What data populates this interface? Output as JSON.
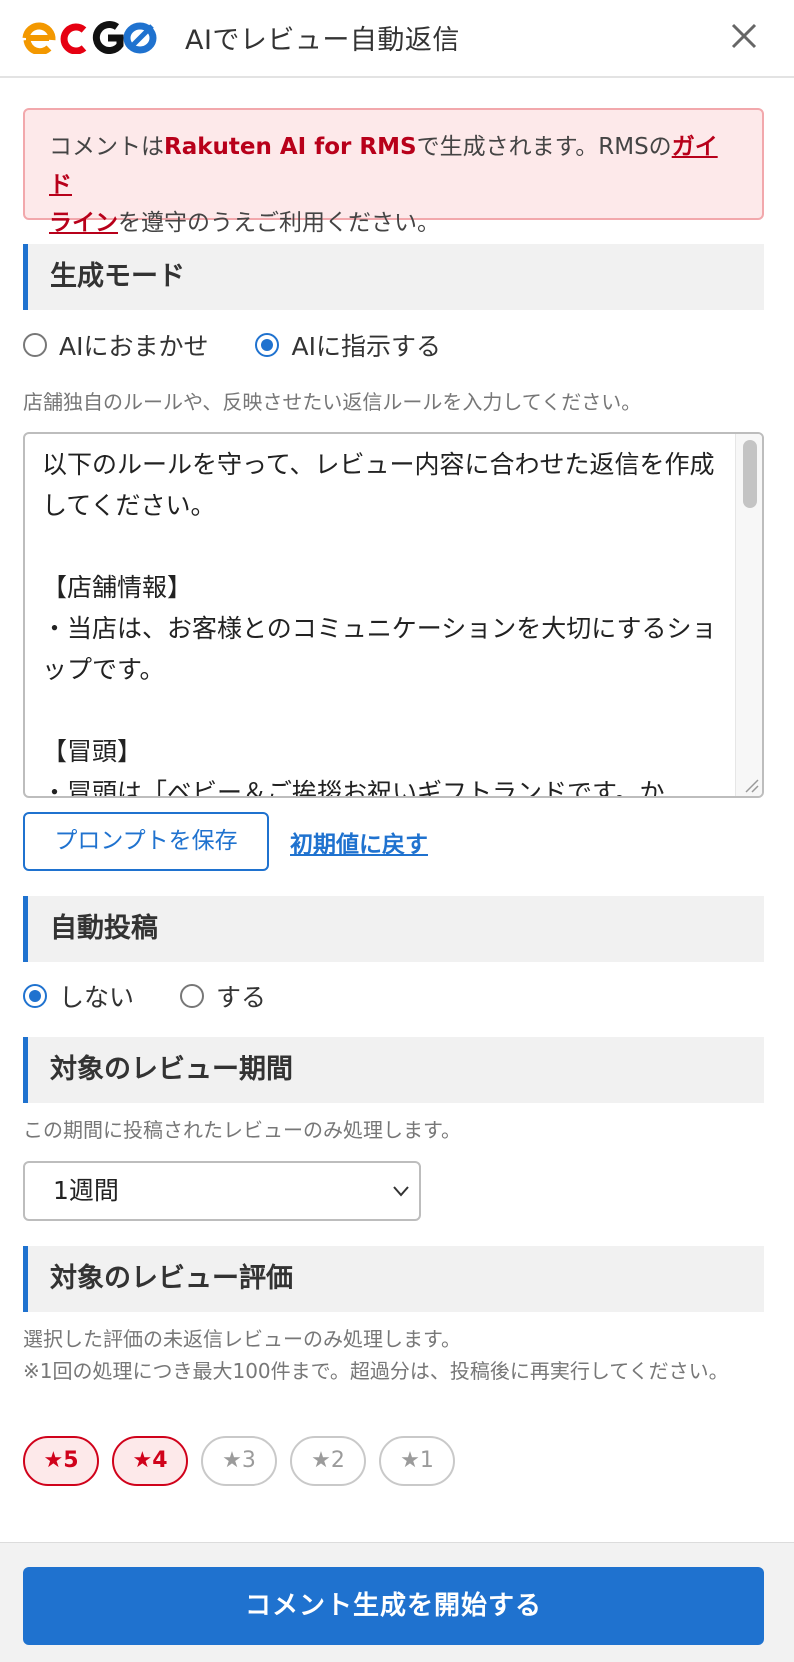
{
  "header": {
    "logo_text": "ecGO",
    "title": "AIでレビュー自動返信"
  },
  "notice": {
    "part1": "コメントは",
    "strong": "Rakuten AI for RMS",
    "part2": "で生成されます。RMSの",
    "link1": "ガイド",
    "link2": "ライン",
    "part3": "を遵守のうえご利用ください。"
  },
  "generation_mode": {
    "heading": "生成モード",
    "options": [
      {
        "label": "AIにおまかせ",
        "checked": false
      },
      {
        "label": "AIに指示する",
        "checked": true
      }
    ],
    "help": "店舗独自のルールや、反映させたい返信ルールを入力してください。",
    "prompt_text": "以下のルールを守って、レビュー内容に合わせた返信を作成してください。\n\n【店舗情報】\n・当店は、お客様とのコミュニケーションを大切にするショップです。\n\n【冒頭】\n・冒頭は「ベビー＆ご挨拶お祝いギフトランドです。か",
    "save_button": "プロンプトを保存",
    "reset_link": "初期値に戻す"
  },
  "auto_post": {
    "heading": "自動投稿",
    "options": [
      {
        "label": "しない",
        "checked": true
      },
      {
        "label": "する",
        "checked": false
      }
    ]
  },
  "review_period": {
    "heading": "対象のレビュー期間",
    "help": "この期間に投稿されたレビューのみ処理します。",
    "selected": "1週間"
  },
  "review_rating": {
    "heading": "対象のレビュー評価",
    "help1": "選択した評価の未返信レビューのみ処理します。",
    "help2": "※1回の処理につき最大100件まで。超過分は、投稿後に再実行してください。",
    "chips": [
      {
        "label": "★5",
        "selected": true
      },
      {
        "label": "★4",
        "selected": true
      },
      {
        "label": "★3",
        "selected": false
      },
      {
        "label": "★2",
        "selected": false
      },
      {
        "label": "★1",
        "selected": false
      }
    ]
  },
  "footer": {
    "start_button": "コメント生成を開始する"
  },
  "colors": {
    "accent": "#1f72cf",
    "alert_text": "#b8001a",
    "alert_bg": "#fde9ea",
    "chip_selected": "#d0021b"
  }
}
